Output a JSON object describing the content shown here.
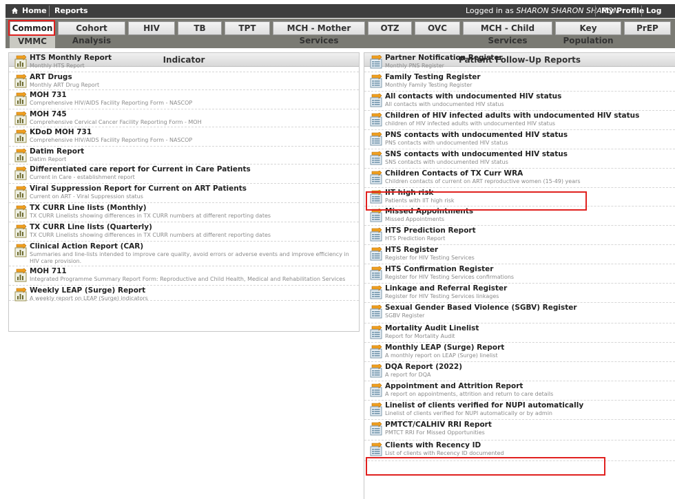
{
  "topbar": {
    "home_label": "Home",
    "reports_label": "Reports",
    "logged_in_prefix": "Logged in as ",
    "user_name": "SHARON SHARON SHARON",
    "profile_label": "My Profile",
    "logout_label": "Log Out"
  },
  "tabs": {
    "items": [
      "Common",
      "Cohort Analysis",
      "HIV",
      "TB",
      "TPT",
      "MCH - Mother Services",
      "OTZ",
      "OVC",
      "MCH - Child Services",
      "Key Population",
      "PrEP"
    ],
    "vmmc": "VMMC",
    "active": "Common"
  },
  "indicator": {
    "header": "Indicator",
    "rows": [
      {
        "title": "HTS Monthly Report",
        "desc": "Monthly HTS Report"
      },
      {
        "title": "ART Drugs",
        "desc": "Monthly ART Drug Report"
      },
      {
        "title": "MOH 731",
        "desc": "Comprehensive HIV/AIDS Facility Reporting Form - NASCOP"
      },
      {
        "title": "MOH 745",
        "desc": "Comprehensive Cervical Cancer Facility Reporting Form - MOH"
      },
      {
        "title": "KDoD MOH 731",
        "desc": "Comprehensive HIV/AIDS Facility Reporting Form - NASCOP"
      },
      {
        "title": "Datim Report",
        "desc": "Datim Report"
      },
      {
        "title": "Differentiated care report for Current in Care Patients",
        "desc": "Current in Care - establishment report"
      },
      {
        "title": "Viral Suppression Report for Current on ART Patients",
        "desc": "Current on ART - Viral Suppression status"
      },
      {
        "title": "TX CURR Line lists (Monthly)",
        "desc": "TX CURR Linelists showing differences in TX CURR numbers at different reporting dates"
      },
      {
        "title": "TX CURR Line lists (Quarterly)",
        "desc": "TX CURR Linelists showing differences in TX CURR numbers at different reporting dates"
      },
      {
        "title": "Clinical Action Report (CAR)",
        "desc": "Summaries and line-lists intended to improve care quality, avoid errors or adverse events and improve efficiency in HIV care provision."
      },
      {
        "title": "MOH 711",
        "desc": "Integrated Programme Summary Report Form: Reproductive and Child Health, Medical and Rehabilitation Services"
      },
      {
        "title": "Weekly LEAP (Surge) Report",
        "desc": "A weekly report on LEAP (Surge) indicators"
      }
    ]
  },
  "followup": {
    "header": "Patient Follow-Up Reports",
    "rows": [
      {
        "title": "Partner Notification Register",
        "desc": "Monthly PNS Register"
      },
      {
        "title": "Family Testing Register",
        "desc": "Monthly Family Testing Register"
      },
      {
        "title": "All contacts with undocumented HIV status",
        "desc": "All contacts with undocumented HIV status"
      },
      {
        "title": "Children of HIV infected adults with undocumented HIV status",
        "desc": "children of HIV infected adults with undocumented HIV status"
      },
      {
        "title": "PNS contacts with undocumented HIV status",
        "desc": "PNS contacts with undocumented HIV status"
      },
      {
        "title": "SNS contacts with undocumented HIV status",
        "desc": "SNS contacts with undocumented HIV status"
      },
      {
        "title": "Children Contacts of TX Curr WRA",
        "desc": "Children contacts of current on ART reproductive women (15-49) years"
      },
      {
        "title": "IIT high risk",
        "desc": "Patients with IIT high risk"
      },
      {
        "title": "Missed Appointments",
        "desc": "Missed Appointments"
      },
      {
        "title": "HTS Prediction Report",
        "desc": "HTS Prediction Report"
      },
      {
        "title": "HTS Register",
        "desc": "Register for HIV Testing Services"
      },
      {
        "title": "HTS Confirmation Register",
        "desc": "Register for HIV Testing Services confirmations"
      },
      {
        "title": "Linkage and Referral Register",
        "desc": "Register for HIV Testing Services linkages"
      },
      {
        "title": "Sexual Gender Based Violence (SGBV) Register",
        "desc": "SGBV Register"
      },
      {
        "title": "Mortality Audit Linelist",
        "desc": "Report for Mortality Audit"
      },
      {
        "title": "Monthly LEAP (Surge) Report",
        "desc": "A monthly report on LEAP (Surge) linelist"
      },
      {
        "title": "DQA Report (2022)",
        "desc": "A report for DQA"
      },
      {
        "title": "Appointment and Attrition Report",
        "desc": "A report on appointments, attrition and return to care details"
      },
      {
        "title": "Linelist of clients verified for NUPI automatically",
        "desc": "Linelist of clients verified for NUPI automatically or by admin"
      },
      {
        "title": "PMTCT/CALHIV RRI Report",
        "desc": "PMTCT RRI For Missed Opportunities"
      },
      {
        "title": "Clients with Recency ID",
        "desc": "List of clients with Recency ID documented"
      }
    ]
  },
  "colors": {
    "topbar_bg": "#3e3e3e",
    "tabstrip_bg": "#7a7a73",
    "highlight": "#e0201e"
  }
}
